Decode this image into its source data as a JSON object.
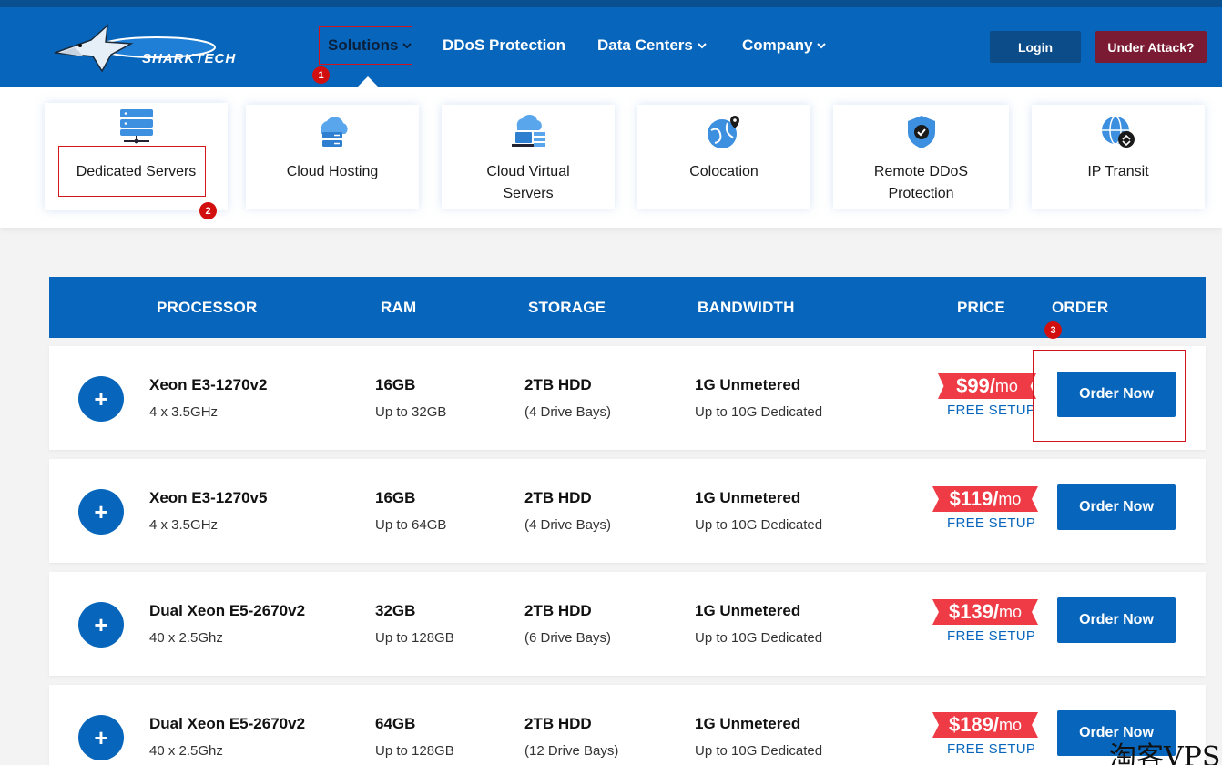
{
  "header": {
    "brand": "SHARKTECH",
    "nav": [
      {
        "label": "Solutions"
      },
      {
        "label": "DDoS Protection"
      },
      {
        "label": "Data Centers"
      },
      {
        "label": "Company"
      }
    ],
    "login_label": "Login",
    "attack_label": "Under Attack?"
  },
  "annotations": [
    "1",
    "2",
    "3"
  ],
  "mega_menu": [
    {
      "label": "Dedicated Servers",
      "icon": "server-rack-icon"
    },
    {
      "label": "Cloud Hosting",
      "icon": "cloud-server-icon"
    },
    {
      "label": "Cloud Virtual Servers",
      "icon": "cloud-vps-icon"
    },
    {
      "label": "Colocation",
      "icon": "globe-pin-icon"
    },
    {
      "label": "Remote DDoS Protection",
      "icon": "shield-check-icon"
    },
    {
      "label": "IP Transit",
      "icon": "globe-transit-icon"
    }
  ],
  "table": {
    "headers": [
      "PROCESSOR",
      "RAM",
      "STORAGE",
      "BANDWIDTH",
      "PRICE",
      "ORDER"
    ],
    "rows": [
      {
        "cpu": "Xeon E3-1270v2",
        "cpu_sub": "4 x 3.5GHz",
        "ram": "16GB",
        "ram_sub": "Up to 32GB",
        "storage": "2TB HDD",
        "storage_sub": "(4 Drive Bays)",
        "bw": "1G Unmetered",
        "bw_sub": "Up to 10G Dedicated",
        "price": "$99/",
        "unit": "mo",
        "setup": "FREE SETUP",
        "order": "Order Now"
      },
      {
        "cpu": "Xeon E3-1270v5",
        "cpu_sub": "4 x 3.5GHz",
        "ram": "16GB",
        "ram_sub": "Up to 64GB",
        "storage": "2TB HDD",
        "storage_sub": "(4 Drive Bays)",
        "bw": "1G Unmetered",
        "bw_sub": "Up to 10G Dedicated",
        "price": "$119/",
        "unit": "mo",
        "setup": "FREE SETUP",
        "order": "Order Now"
      },
      {
        "cpu": "Dual Xeon E5-2670v2",
        "cpu_sub": "40 x 2.5Ghz",
        "ram": "32GB",
        "ram_sub": "Up to 128GB",
        "storage": "2TB HDD",
        "storage_sub": "(6 Drive Bays)",
        "bw": "1G Unmetered",
        "bw_sub": "Up to 10G Dedicated",
        "price": "$139/",
        "unit": "mo",
        "setup": "FREE SETUP",
        "order": "Order Now"
      },
      {
        "cpu": "Dual Xeon E5-2670v2",
        "cpu_sub": "40 x 2.5Ghz",
        "ram": "64GB",
        "ram_sub": "Up to 128GB",
        "storage": "2TB HDD",
        "storage_sub": "(12 Drive Bays)",
        "bw": "1G Unmetered",
        "bw_sub": "Up to 10G Dedicated",
        "price": "$189/",
        "unit": "mo",
        "setup": "FREE SETUP",
        "order": "Order Now"
      }
    ]
  },
  "watermark": "淘客VPS",
  "colors": {
    "brand_blue": "#0766bb",
    "attack_red": "#7a1b33",
    "price_red": "#ee3b45",
    "annotation_red": "#d20f0f"
  }
}
